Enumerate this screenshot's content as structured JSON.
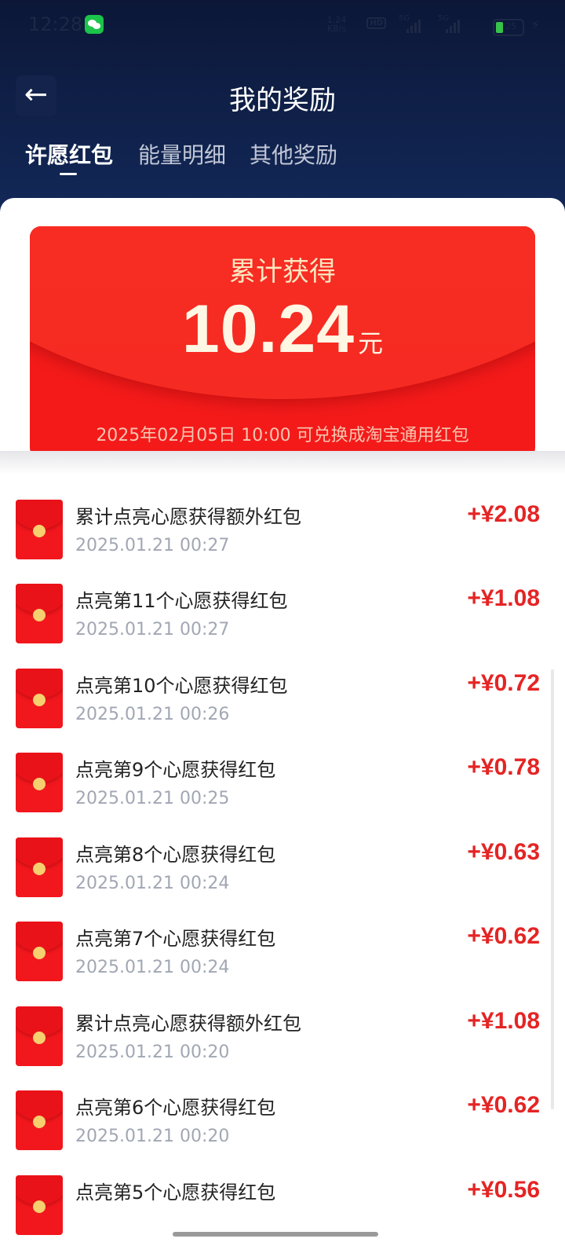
{
  "status_bar": {
    "time": "12:28",
    "speed": "1.24 KB/s",
    "hd": "HD",
    "signal1": "5G",
    "signal2": "5G",
    "battery": "25"
  },
  "header": {
    "title": "我的奖励",
    "tabs": [
      {
        "label": "许愿红包"
      },
      {
        "label": "能量明细"
      },
      {
        "label": "其他奖励"
      }
    ]
  },
  "card": {
    "label": "累计获得",
    "amount": "10.24",
    "unit": "元",
    "note": "2025年02月05日 10:00 可兑换成淘宝通用红包"
  },
  "records": [
    {
      "title": "累计点亮心愿获得额外红包",
      "date": "2025.01.21 00:27",
      "amount": "+¥2.08"
    },
    {
      "title": "点亮第11个心愿获得红包",
      "date": "2025.01.21 00:27",
      "amount": "+¥1.08"
    },
    {
      "title": "点亮第10个心愿获得红包",
      "date": "2025.01.21 00:26",
      "amount": "+¥0.72"
    },
    {
      "title": "点亮第9个心愿获得红包",
      "date": "2025.01.21 00:25",
      "amount": "+¥0.78"
    },
    {
      "title": "点亮第8个心愿获得红包",
      "date": "2025.01.21 00:24",
      "amount": "+¥0.63"
    },
    {
      "title": "点亮第7个心愿获得红包",
      "date": "2025.01.21 00:24",
      "amount": "+¥0.62"
    },
    {
      "title": "累计点亮心愿获得额外红包",
      "date": "2025.01.21 00:20",
      "amount": "+¥1.08"
    },
    {
      "title": "点亮第6个心愿获得红包",
      "date": "2025.01.21 00:20",
      "amount": "+¥0.62"
    },
    {
      "title": "点亮第5个心愿获得红包",
      "date": "",
      "amount": "+¥0.56"
    }
  ],
  "icons": {
    "back": "arrow-left-icon",
    "record": "red-envelope-icon",
    "app_notification": "wechat-icon"
  },
  "colors": {
    "header_bg": "#0f1d44",
    "card_red": "#f41a1a",
    "amount_red": "#e52424",
    "coin_gold": "#f6cf6f"
  }
}
